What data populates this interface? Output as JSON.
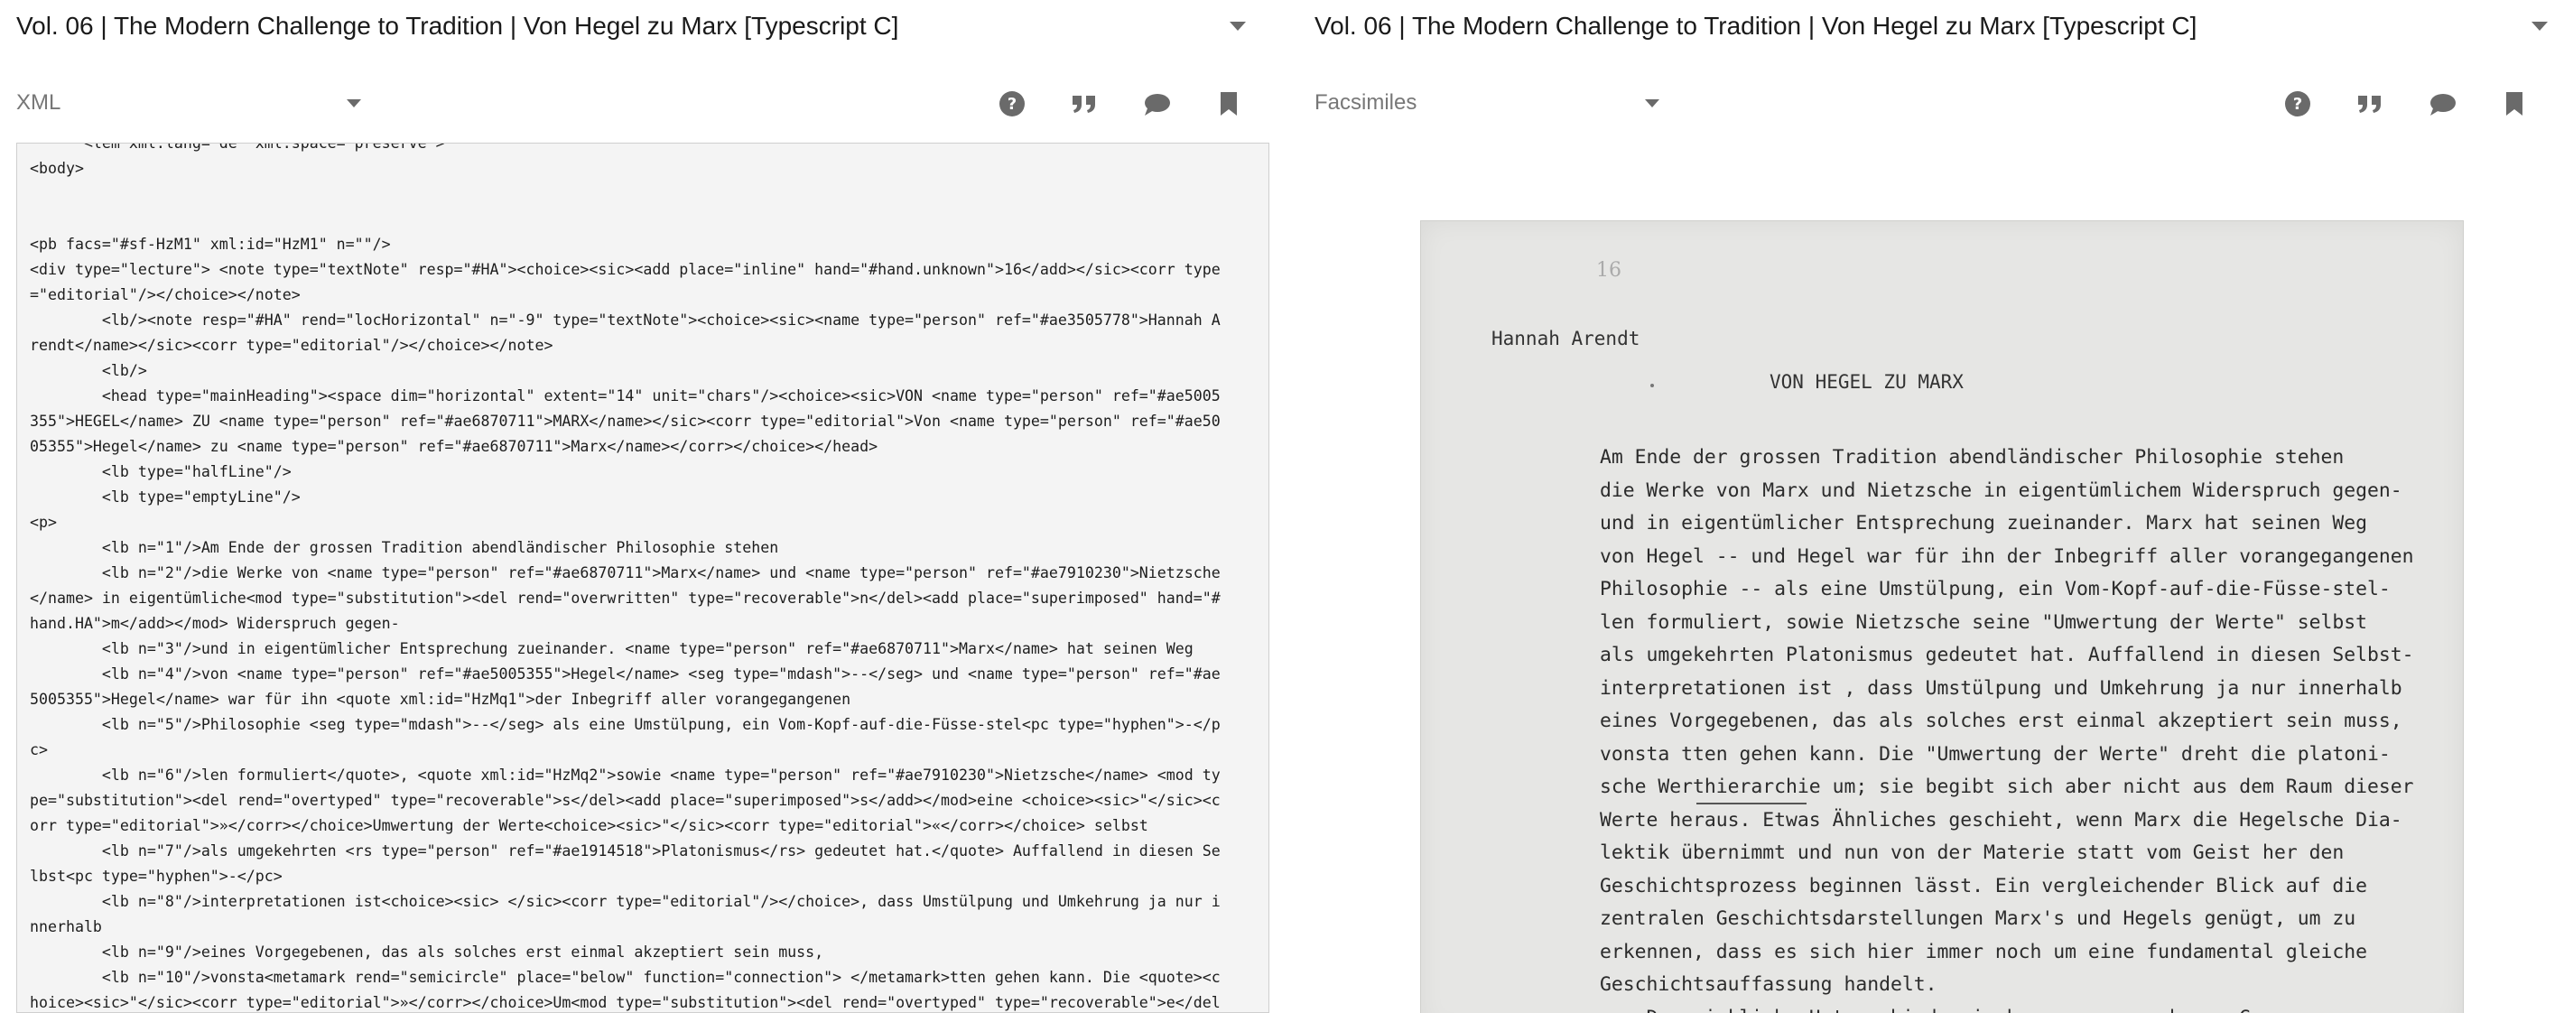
{
  "left_pane": {
    "title": "Vol. 06 | The Modern Challenge to Tradition | Von Hegel zu Marx [Typescript C]",
    "view_selector": "XML",
    "xml_lines": [
      "      <lem xml:lang=\"de\" xml:space=\"preserve\">",
      "<body>",
      "",
      "",
      "<pb facs=\"#sf-HzM1\" xml:id=\"HzM1\" n=\"\"/>",
      "<div type=\"lecture\"> <note type=\"textNote\" resp=\"#HA\"><choice><sic><add place=\"inline\" hand=\"#hand.unknown\">16</add></sic><corr type",
      "=\"editorial\"/></choice></note>",
      "        <lb/><note resp=\"#HA\" rend=\"locHorizontal\" n=\"-9\" type=\"textNote\"><choice><sic><name type=\"person\" ref=\"#ae3505778\">Hannah A",
      "rendt</name></sic><corr type=\"editorial\"/></choice></note>",
      "        <lb/>",
      "        <head type=\"mainHeading\"><space dim=\"horizontal\" extent=\"14\" unit=\"chars\"/><choice><sic>VON <name type=\"person\" ref=\"#ae5005",
      "355\">HEGEL</name> ZU <name type=\"person\" ref=\"#ae6870711\">MARX</name></sic><corr type=\"editorial\">Von <name type=\"person\" ref=\"#ae50",
      "05355\">Hegel</name> zu <name type=\"person\" ref=\"#ae6870711\">Marx</name></corr></choice></head>",
      "        <lb type=\"halfLine\"/>",
      "        <lb type=\"emptyLine\"/>",
      "<p>",
      "        <lb n=\"1\"/>Am Ende der grossen Tradition abendländischer Philosophie stehen",
      "        <lb n=\"2\"/>die Werke von <name type=\"person\" ref=\"#ae6870711\">Marx</name> und <name type=\"person\" ref=\"#ae7910230\">Nietzsche",
      "</name> in eigentümliche<mod type=\"substitution\"><del rend=\"overwritten\" type=\"recoverable\">n</del><add place=\"superimposed\" hand=\"#",
      "hand.HA\">m</add></mod> Widerspruch gegen-",
      "        <lb n=\"3\"/>und in eigentümlicher Entsprechung zueinander. <name type=\"person\" ref=\"#ae6870711\">Marx</name> hat seinen Weg",
      "        <lb n=\"4\"/>von <name type=\"person\" ref=\"#ae5005355\">Hegel</name> <seg type=\"mdash\">--</seg> und <name type=\"person\" ref=\"#ae",
      "5005355\">Hegel</name> war für ihn <quote xml:id=\"HzMq1\">der Inbegriff aller vorangegangenen",
      "        <lb n=\"5\"/>Philosophie <seg type=\"mdash\">--</seg> als eine Umstülpung, ein Vom-Kopf-auf-die-Füsse-stel<pc type=\"hyphen\">-</p",
      "c>",
      "        <lb n=\"6\"/>len formuliert</quote>, <quote xml:id=\"HzMq2\">sowie <name type=\"person\" ref=\"#ae7910230\">Nietzsche</name> <mod ty",
      "pe=\"substitution\"><del rend=\"overtyped\" type=\"recoverable\">s</del><add place=\"superimposed\">s</add></mod>eine <choice><sic>\"</sic><c",
      "orr type=\"editorial\">»</corr></choice>Umwertung der Werte<choice><sic>\"</sic><corr type=\"editorial\">«</corr></choice> selbst",
      "        <lb n=\"7\"/>als umgekehrten <rs type=\"person\" ref=\"#ae1914518\">Platonismus</rs> gedeutet hat.</quote> Auffallend in diesen Se",
      "lbst<pc type=\"hyphen\">-</pc>",
      "        <lb n=\"8\"/>interpretationen ist<choice><sic> </sic><corr type=\"editorial\"/></choice>, dass Umstülpung und Umkehrung ja nur i",
      "nnerhalb",
      "        <lb n=\"9\"/>eines Vorgegebenen, das als solches erst einmal akzeptiert sein muss,",
      "        <lb n=\"10\"/>vonsta<metamark rend=\"semicircle\" place=\"below\" function=\"connection\"> </metamark>tten gehen kann. Die <quote><c",
      "hoice><sic>\"</sic><corr type=\"editorial\">»</corr></choice>Um<mod type=\"substitution\"><del rend=\"overtyped\" type=\"recoverable\">e</del"
    ]
  },
  "right_pane": {
    "title": "Vol. 06 | The Modern Challenge to Tradition | Von Hegel zu Marx [Typescript C]",
    "view_selector": "Facsimiles",
    "facsimile": {
      "page_number": "16",
      "author": "Hannah Arendt",
      "heading": "VON HEGEL ZU MARX",
      "lines": [
        "Am Ende der grossen Tradition abendländischer Philosophie stehen",
        "die Werke von Marx und Nietzsche in eigentümlichem Widerspruch gegen-",
        "und in eigentümlicher Entsprechung zueinander. Marx hat seinen Weg",
        "von Hegel -- und Hegel war für ihn der Inbegriff aller vorangegangenen",
        "Philosophie -- als eine Umstülpung, ein Vom-Kopf-auf-die-Füsse-stel-",
        "len formuliert, sowie Nietzsche seine \"Umwertung der Werte\" selbst",
        "als umgekehrten Platonismus gedeutet hat. Auffallend in diesen Selbst-",
        "interpretationen ist , dass Umstülpung und Umkehrung ja nur innerhalb",
        "eines Vorgegebenen, das als solches erst einmal akzeptiert sein muss,",
        "vonsta tten gehen kann. Die \"Umwertung der Werte\" dreht die platoni-",
        "sche Werthierarchie um; sie begibt sich aber nicht aus dem Raum dieser",
        "Werte heraus. Etwas Ähnliches geschieht, wenn Marx die Hegelsche Dia-",
        "lektik übernimmt und nun von der Materie statt vom Geist her den",
        "Geschichtsprozess beginnen lässt. Ein vergleichender Blick auf die",
        "zentralen Geschichtsdarstellungen Marx's und Hegels genügt, um zu",
        "erkennen, dass es sich hier immer noch um eine fundamental gleiche",
        "Geschichtsauffassung handelt.",
        "    Der wirkliche Unterschied zwischen ausgesprochenen Ge-"
      ]
    }
  },
  "icons": {
    "help": "help-circle-icon",
    "cite": "quote-icon",
    "comment": "comment-icon",
    "bookmark": "bookmark-icon"
  },
  "colors": {
    "icon": "#6a6a6a",
    "xml_background": "#f4f4f4",
    "paper": "#e6e6e4"
  }
}
